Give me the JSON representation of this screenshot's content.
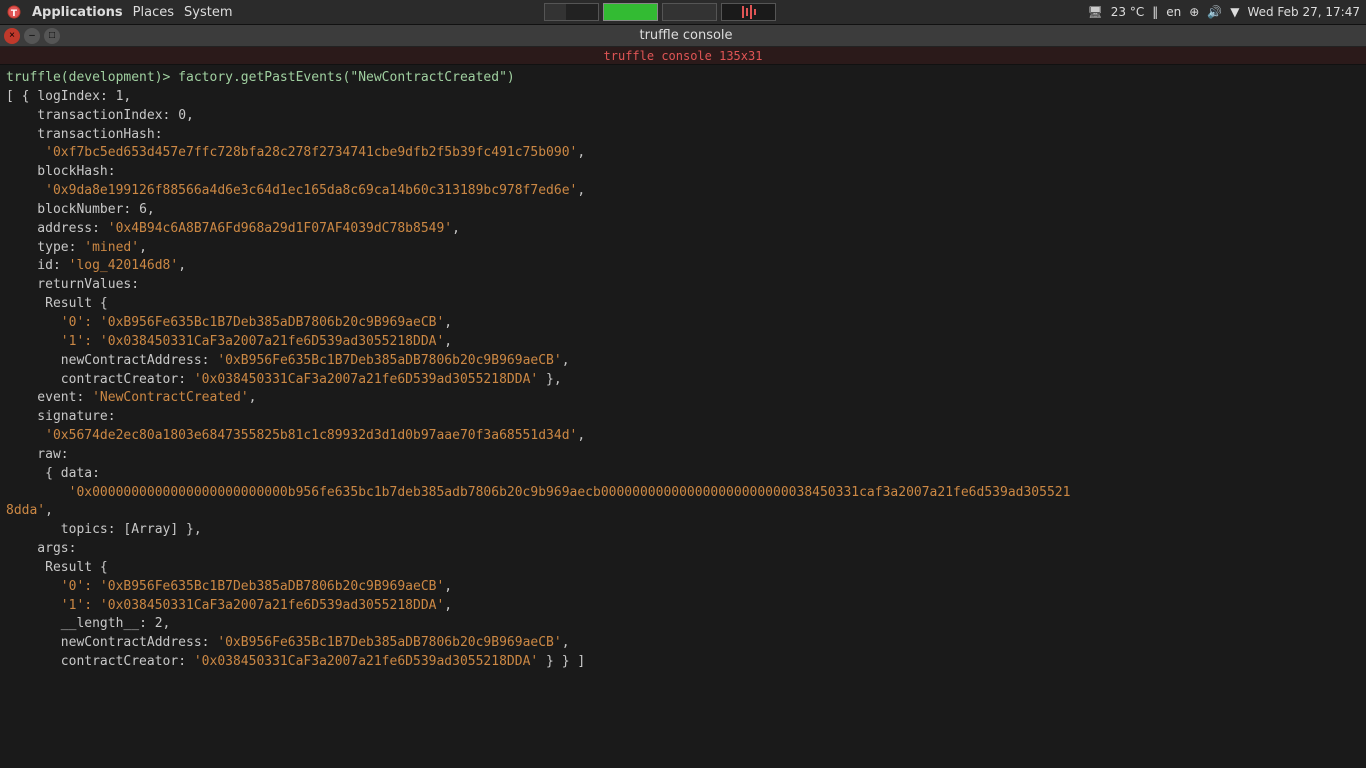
{
  "systemBar": {
    "applications": "Applications",
    "places": "Places",
    "system": "System",
    "rightItems": "23 °C  ‖  en  ⊕  🔊  ▼  Wed Feb 27, 17:47"
  },
  "titleBar": {
    "title": "truffle console",
    "closeLabel": "×",
    "minLabel": "–",
    "maxLabel": "□"
  },
  "subtitleBar": {
    "label": "truffle console 135x31"
  },
  "terminal": {
    "prompt": "truffle(development)> factory.getPastEvents(\"NewContractCreated\")",
    "content": "..."
  }
}
